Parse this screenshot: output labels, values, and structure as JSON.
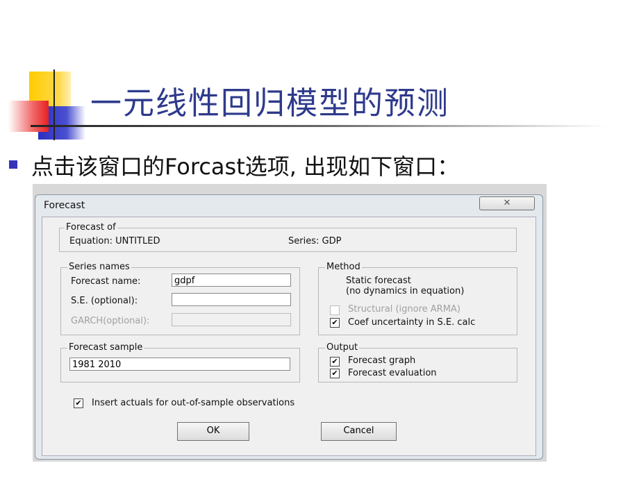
{
  "slide": {
    "title": "一元线性回归模型的预测",
    "bullet_pre": "点击该窗口的",
    "bullet_bold": "Forcast",
    "bullet_post": "选项, 出现如下窗口：",
    "accent": "#2e3a8c"
  },
  "dialog": {
    "title": "Forecast",
    "close_icon": "close-icon",
    "forecast_of": {
      "legend": "Forecast of",
      "equation": "Equation: UNTITLED",
      "series": "Series: GDP"
    },
    "series_names": {
      "legend": "Series names",
      "forecast_name_label": "Forecast name:",
      "forecast_name_value": "gdpf",
      "se_label": "S.E. (optional):",
      "se_value": "",
      "garch_label": "GARCH(optional):",
      "garch_value": ""
    },
    "method": {
      "legend": "Method",
      "line1": "Static forecast",
      "line2": "(no dynamics in equation)",
      "structural": "Structural (ignore ARMA)",
      "structural_checked": false,
      "coef": "Coef uncertainty in S.E. calc",
      "coef_checked": true
    },
    "sample": {
      "legend": "Forecast sample",
      "value": "1981 2010"
    },
    "output": {
      "legend": "Output",
      "graph": "Forecast graph",
      "graph_checked": true,
      "evaluation": "Forecast evaluation",
      "evaluation_checked": true
    },
    "insert_actuals": "Insert actuals for out-of-sample observations",
    "insert_actuals_checked": true,
    "ok": "OK",
    "cancel": "Cancel",
    "check_mark": "✔"
  }
}
